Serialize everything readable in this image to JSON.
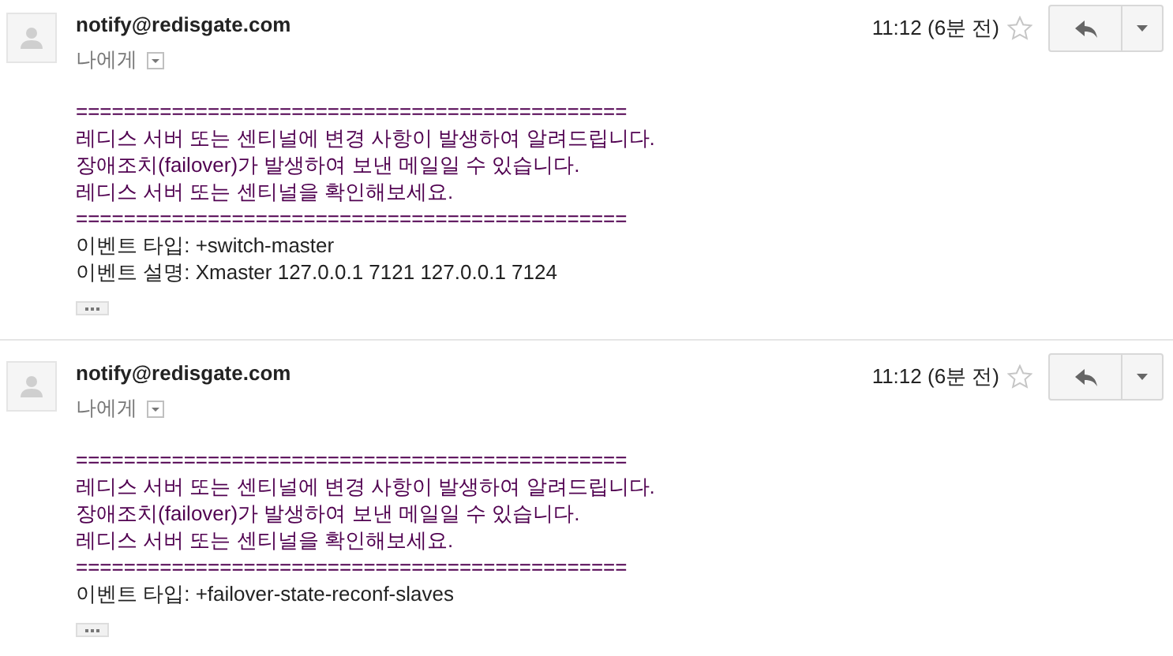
{
  "messages": [
    {
      "sender": "notify@redisgate.com",
      "recipient": "나에게",
      "time": "11:12 (6분 전)",
      "starred": false,
      "lines": [
        {
          "kind": "quoted",
          "text": "=============================================="
        },
        {
          "kind": "quoted",
          "text": "레디스 서버 또는 센티널에 변경 사항이 발생하여 알려드립니다."
        },
        {
          "kind": "quoted",
          "text": "장애조치(failover)가 발생하여 보낸 메일일 수 있습니다."
        },
        {
          "kind": "quoted",
          "text": "레디스 서버 또는 센티널을 확인해보세요."
        },
        {
          "kind": "quoted",
          "text": "=============================================="
        },
        {
          "kind": "plain",
          "text": "이벤트 타입: +switch-master"
        },
        {
          "kind": "plain",
          "text": "이벤트 설명: Xmaster 127.0.0.1 7121 127.0.0.1 7124"
        }
      ]
    },
    {
      "sender": "notify@redisgate.com",
      "recipient": "나에게",
      "time": "11:12 (6분 전)",
      "starred": false,
      "lines": [
        {
          "kind": "quoted",
          "text": "=============================================="
        },
        {
          "kind": "quoted",
          "text": "레디스 서버 또는 센티널에 변경 사항이 발생하여 알려드립니다."
        },
        {
          "kind": "quoted",
          "text": "장애조치(failover)가 발생하여 보낸 메일일 수 있습니다."
        },
        {
          "kind": "quoted",
          "text": "레디스 서버 또는 센티널을 확인해보세요."
        },
        {
          "kind": "quoted",
          "text": "=============================================="
        },
        {
          "kind": "plain",
          "text": "이벤트 타입: +failover-state-reconf-slaves"
        }
      ]
    }
  ]
}
